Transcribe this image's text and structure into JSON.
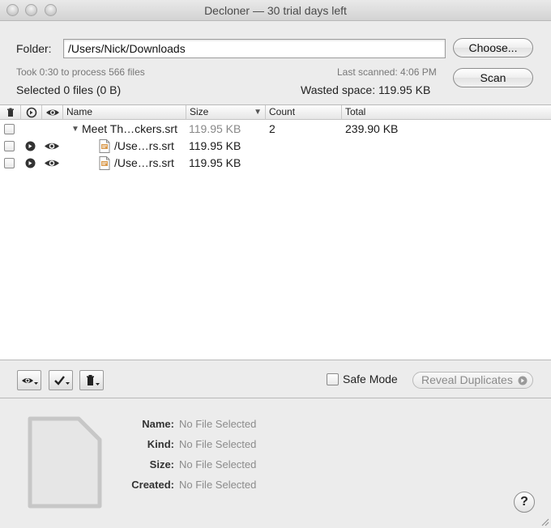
{
  "window": {
    "title": "Decloner — 30 trial days left"
  },
  "top": {
    "folder_label": "Folder:",
    "folder_value": "/Users/Nick/Downloads",
    "choose_label": "Choose...",
    "scan_label": "Scan",
    "process_info": "Took 0:30 to process 566 files",
    "last_scanned": "Last scanned: 4:06 PM",
    "selected_info": "Selected 0 files (0 B)",
    "wasted_space": "Wasted space: 119.95 KB"
  },
  "table": {
    "columns": {
      "name": "Name",
      "size": "Size",
      "count": "Count",
      "total": "Total"
    },
    "group": {
      "name": "Meet Th…ckers.srt",
      "size": "119.95 KB",
      "count": "2",
      "total": "239.90 KB"
    },
    "rows": [
      {
        "name": "/Use…rs.srt",
        "size": "119.95 KB"
      },
      {
        "name": "/Use…rs.srt",
        "size": "119.95 KB"
      }
    ]
  },
  "toolbar": {
    "safe_mode_label": "Safe Mode",
    "reveal_label": "Reveal Duplicates"
  },
  "info": {
    "name_key": "Name:",
    "name_val": "No File Selected",
    "kind_key": "Kind:",
    "kind_val": "No File Selected",
    "size_key": "Size:",
    "size_val": "No File Selected",
    "created_key": "Created:",
    "created_val": "No File Selected",
    "help_label": "?"
  }
}
